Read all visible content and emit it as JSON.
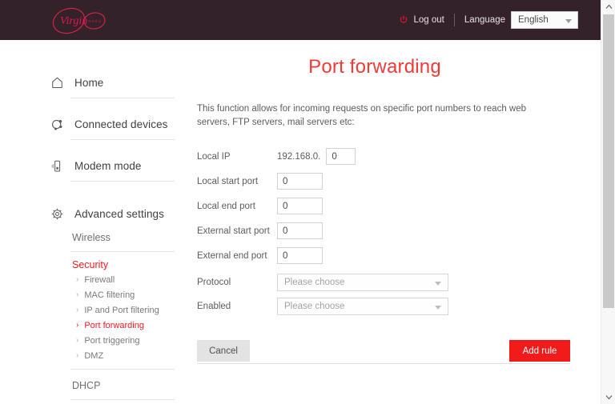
{
  "header": {
    "logo_name": "Virgin Media",
    "logo_word": "virgin",
    "logo_sub": "media",
    "logout_label": "Log out",
    "power_icon": "power-icon",
    "language_label": "Language",
    "language_value": "English",
    "language_options": [
      "English"
    ],
    "background_color": "#332229"
  },
  "sidebar": {
    "top_items": [
      {
        "label": "Home",
        "icon": "home-icon"
      },
      {
        "label": "Connected devices",
        "icon": "connected-devices-icon"
      },
      {
        "label": "Modem mode",
        "icon": "modem-icon"
      },
      {
        "label": "Advanced settings",
        "icon": "gear-icon"
      }
    ],
    "sections": [
      {
        "label": "Wireless",
        "active": false
      },
      {
        "label": "Security",
        "active": true
      },
      {
        "label": "DHCP",
        "active": false
      }
    ],
    "security_children": [
      {
        "label": "Firewall",
        "active": false
      },
      {
        "label": "MAC filtering",
        "active": false
      },
      {
        "label": "IP and Port filtering",
        "active": false
      },
      {
        "label": "Port forwarding",
        "active": true
      },
      {
        "label": "Port triggering",
        "active": false
      },
      {
        "label": "DMZ",
        "active": false
      }
    ],
    "chevron": "›"
  },
  "main": {
    "title": "Port forwarding",
    "title_color": "#f13a36",
    "description": "This function allows for incoming requests on specific port numbers to reach web servers, FTP servers, mail servers etc:",
    "fields": [
      {
        "label": "Local IP",
        "prefix": "192.168.0.",
        "value": "0",
        "placeholder": "0",
        "kind": "ip"
      },
      {
        "label": "Local start port",
        "value": "0",
        "placeholder": "0",
        "kind": "text"
      },
      {
        "label": "Local end port",
        "value": "0",
        "placeholder": "0",
        "kind": "text"
      },
      {
        "label": "External start port",
        "value": "0",
        "placeholder": "0",
        "kind": "text"
      },
      {
        "label": "External end port",
        "value": "0",
        "placeholder": "0",
        "kind": "text"
      }
    ],
    "selects": [
      {
        "label": "Protocol",
        "value": "Please choose",
        "options": [
          "Please choose"
        ]
      },
      {
        "label": "Enabled",
        "value": "Please choose",
        "options": [
          "Please choose"
        ]
      }
    ],
    "cancel_label": "Cancel",
    "add_label": "Add rule",
    "add_color": "#f21b1b"
  },
  "scrollbar": {
    "up_icon": "chevron-up-icon",
    "down_icon": "chevron-down-icon"
  }
}
